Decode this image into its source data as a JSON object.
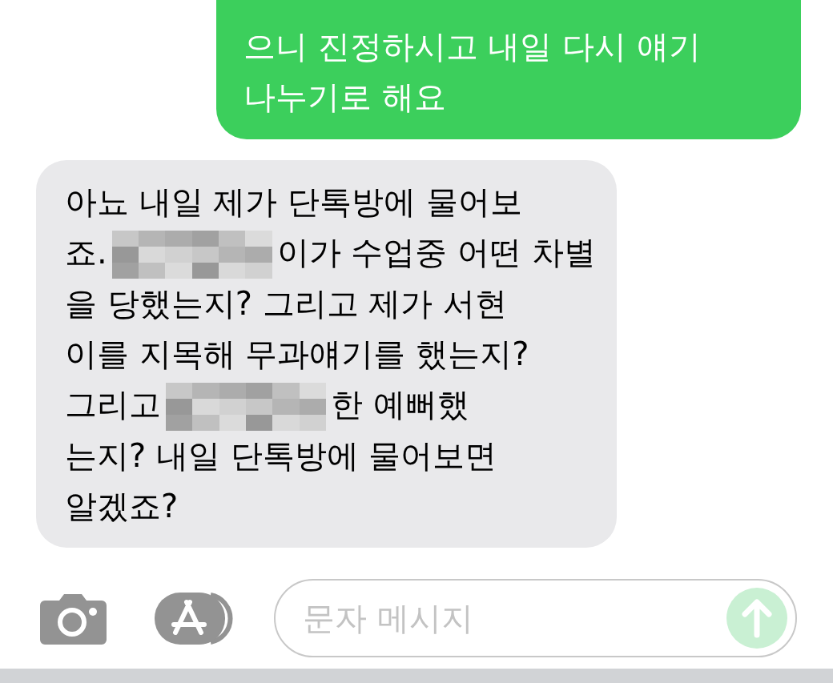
{
  "messages": [
    {
      "kind": "sent",
      "lines": [
        [
          {
            "kind": "text",
            "text": "으니 진정하시고 내일 다시 얘기"
          }
        ],
        [
          {
            "kind": "text",
            "text": "나누기로 해요"
          }
        ]
      ]
    },
    {
      "kind": "received",
      "lines": [
        [
          {
            "kind": "text",
            "text": "아뇨 내일 제가 단톡방에 물어보"
          }
        ],
        [
          {
            "kind": "text",
            "text": "죠."
          },
          {
            "kind": "redacted"
          },
          {
            "kind": "text",
            "text": "이가 수업중 어떤 차별"
          }
        ],
        [
          {
            "kind": "text",
            "text": "을 당했는지? 그리고 제가 서현"
          }
        ],
        [
          {
            "kind": "text",
            "text": "이를 지목해 무과얘기를 했는지?"
          }
        ],
        [
          {
            "kind": "text",
            "text": "그리고"
          },
          {
            "kind": "redacted"
          },
          {
            "kind": "text",
            "text": "한 예뻐했"
          }
        ],
        [
          {
            "kind": "text",
            "text": "는지? 내일 단톡방에 물어보면"
          }
        ],
        [
          {
            "kind": "text",
            "text": "알겠죠?"
          }
        ]
      ]
    }
  ],
  "composer": {
    "placeholder": "문자 메시지"
  }
}
